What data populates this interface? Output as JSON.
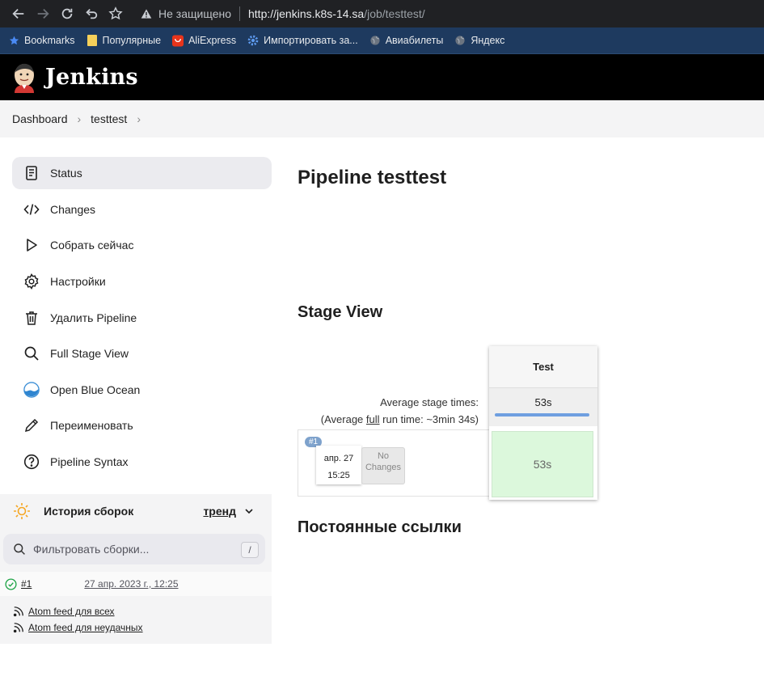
{
  "browser": {
    "security_label": "Не защищено",
    "url_host": "http://jenkins.k8s-14.sa",
    "url_path": "/job/testtest/",
    "bookmarks": [
      {
        "label": "Bookmarks",
        "icon": "star-icon"
      },
      {
        "label": "Популярные",
        "icon": "folder-icon"
      },
      {
        "label": "AliExpress",
        "icon": "aliexpress-icon"
      },
      {
        "label": "Импортировать за...",
        "icon": "gear-icon"
      },
      {
        "label": "Авиабилеты",
        "icon": "globe-icon"
      },
      {
        "label": "Яндекс",
        "icon": "globe-icon"
      }
    ]
  },
  "header": {
    "title": "Jenkins"
  },
  "breadcrumb": [
    "Dashboard",
    "testtest"
  ],
  "sidebar": {
    "items": [
      {
        "label": "Status",
        "icon": "status-icon"
      },
      {
        "label": "Changes",
        "icon": "code-icon"
      },
      {
        "label": "Собрать сейчас",
        "icon": "play-icon"
      },
      {
        "label": "Настройки",
        "icon": "gear-icon"
      },
      {
        "label": "Удалить Pipeline",
        "icon": "trash-icon"
      },
      {
        "label": "Full Stage View",
        "icon": "search-icon"
      },
      {
        "label": "Open Blue Ocean",
        "icon": "blue-ocean-icon"
      },
      {
        "label": "Переименовать",
        "icon": "pencil-icon"
      },
      {
        "label": "Pipeline Syntax",
        "icon": "help-icon"
      }
    ]
  },
  "history": {
    "title": "История сборок",
    "trend_label": "тренд",
    "filter_placeholder": "Фильтровать сборки...",
    "filter_shortcut": "/",
    "builds": [
      {
        "number": "#1",
        "date": "27 апр. 2023 г., 12:25"
      }
    ],
    "feeds": [
      "Atom feed для всех",
      "Atom feed для неудачных"
    ]
  },
  "main": {
    "title": "Pipeline testtest",
    "stage_view_title": "Stage View",
    "avg_label": "Average stage times:",
    "avg_run_prefix": "(Average ",
    "avg_run_link": "full",
    "avg_run_suffix": " run time: ~3min 34s)",
    "stage": {
      "name": "Test",
      "avg": "53s",
      "run_value": "53s"
    },
    "run": {
      "badge": "#1",
      "date": "апр. 27",
      "time": "15:25",
      "changes_line1": "No",
      "changes_line2": "Changes"
    },
    "permalinks_title": "Постоянные ссылки"
  },
  "colors": {
    "header_bg": "#000000",
    "stage_success": "#dcf8dc",
    "stage_bar": "#6e9fe0",
    "build_ok": "#1ea446"
  }
}
